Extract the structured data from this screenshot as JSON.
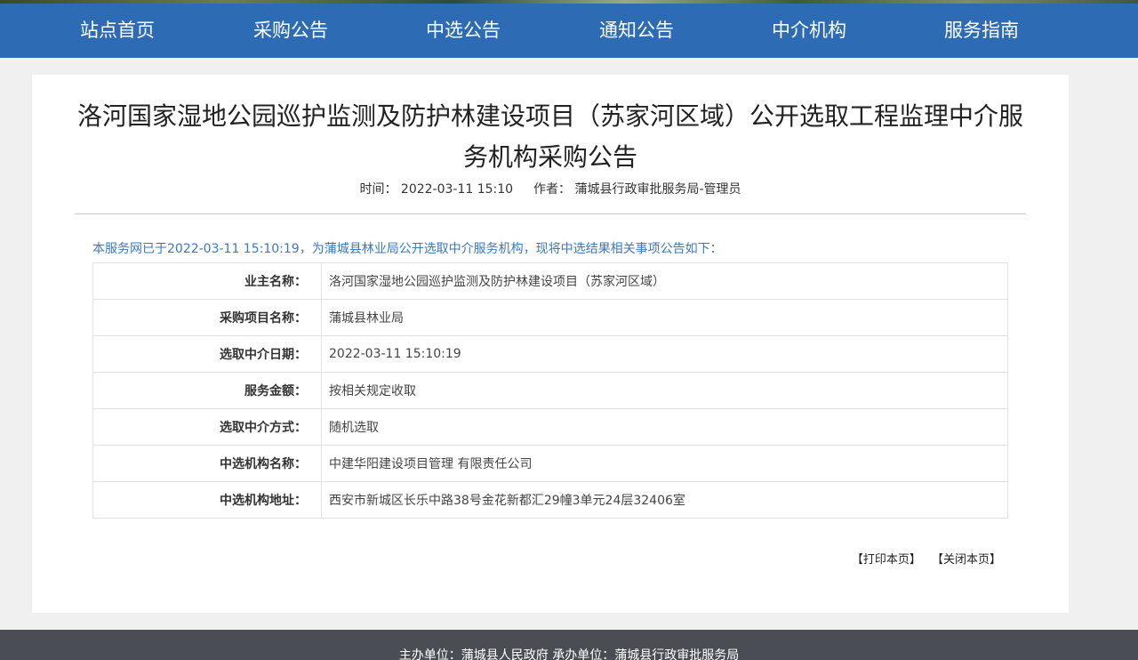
{
  "nav": {
    "items": [
      {
        "label": "站点首页"
      },
      {
        "label": "采购公告"
      },
      {
        "label": "中选公告"
      },
      {
        "label": "通知公告"
      },
      {
        "label": "中介机构"
      },
      {
        "label": "服务指南"
      }
    ]
  },
  "article": {
    "title": "洛河国家湿地公园巡护监测及防护林建设项目（苏家河区域）公开选取工程监理中介服务机构采购公告",
    "time_label": "时间：",
    "time_value": "2022-03-11 15:10",
    "author_label": "作者：",
    "author_value": "蒲城县行政审批服务局-管理员",
    "intro": "本服务网已于2022-03-11 15:10:19，为蒲城县林业局公开选取中介服务机构，现将中选结果相关事项公告如下：",
    "rows": [
      {
        "key": "业主名称：",
        "value": "洛河国家湿地公园巡护监测及防护林建设项目（苏家河区域）"
      },
      {
        "key": "采购项目名称：",
        "value": "蒲城县林业局"
      },
      {
        "key": "选取中介日期：",
        "value": "2022-03-11 15:10:19"
      },
      {
        "key": "服务金额：",
        "value": "按相关规定收取"
      },
      {
        "key": "选取中介方式：",
        "value": "随机选取"
      },
      {
        "key": "中选机构名称：",
        "value": "中建华阳建设项目管理 有限责任公司"
      },
      {
        "key": "中选机构地址：",
        "value": "西安市新城区长乐中路38号金花新都汇29幢3单元24层32406室"
      }
    ]
  },
  "actions": {
    "print": "【打印本页】",
    "close": "【关闭本页】"
  },
  "footer": {
    "text": "主办单位：蒲城县人民政府    承办单位：蒲城县行政审批服务局"
  }
}
